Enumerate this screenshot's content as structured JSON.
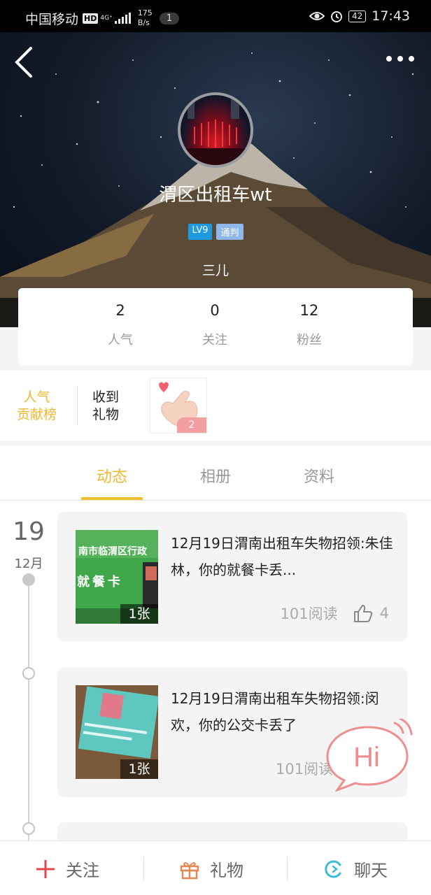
{
  "status_bar": {
    "carrier": "中国移动",
    "hd": "HD",
    "network": "4G⁺",
    "speed_value": "175",
    "speed_unit": "B/s",
    "notification_count": "1",
    "battery": "42",
    "time": "17:43"
  },
  "profile": {
    "username": "渭区出租车wt",
    "level_badge": "LV9",
    "role_badge": "通判",
    "subtitle": "三儿"
  },
  "stats": [
    {
      "value": "2",
      "label": "人气"
    },
    {
      "value": "0",
      "label": "关注"
    },
    {
      "value": "12",
      "label": "粉丝"
    }
  ],
  "gifts": {
    "contrib_line1": "人气",
    "contrib_line2": "贡献榜",
    "received_line1": "收到",
    "received_line2": "礼物",
    "gift_count": "2"
  },
  "tabs": [
    {
      "label": "动态",
      "active": true
    },
    {
      "label": "相册",
      "active": false
    },
    {
      "label": "资料",
      "active": false
    }
  ],
  "timeline": {
    "day": "19",
    "month": "12月"
  },
  "posts": [
    {
      "text": "12月19日渭南出租车失物招领:朱佳林，你的就餐卡丢...",
      "image_count": "1张",
      "reads": "101阅读",
      "likes": "4",
      "thumb_caption_1": "南市临渭区行政",
      "thumb_caption_2": "就餐卡"
    },
    {
      "text": "12月19日渭南出租车失物招领:闵欢，你的公交卡丢了",
      "image_count": "1张",
      "reads": "101阅读"
    }
  ],
  "sticker": {
    "text": "Hi"
  },
  "bottom_bar": {
    "follow": "关注",
    "gift": "礼物",
    "chat": "聊天"
  },
  "colors": {
    "accent_yellow": "#f0b830",
    "level_blue": "#1e9be0",
    "role_blue": "#8fb7e9",
    "follow_red": "#e0464a",
    "gift_orange": "#e08a58",
    "chat_cyan": "#3cbcd8"
  }
}
